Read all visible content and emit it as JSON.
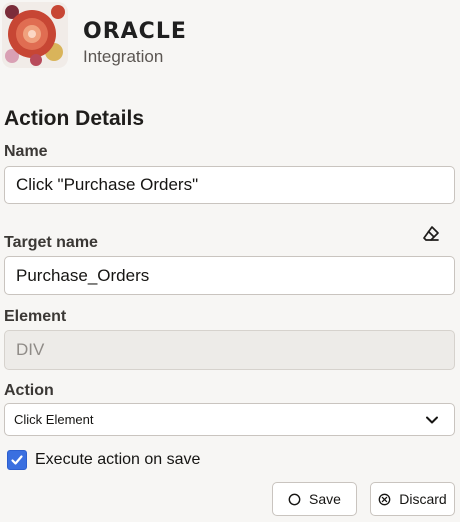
{
  "header": {
    "brand_name": "ORACLE",
    "product_name": "Integration"
  },
  "form": {
    "section_title": "Action Details",
    "name": {
      "label": "Name",
      "value": "Click \"Purchase Orders\""
    },
    "target_name": {
      "label": "Target name",
      "value": "Purchase_Orders",
      "clear_icon": "eraser-icon"
    },
    "element": {
      "label": "Element",
      "value": "DIV"
    },
    "action": {
      "label": "Action",
      "selected": "Click Element"
    },
    "execute_on_save": {
      "label": "Execute action on save",
      "checked": true
    }
  },
  "buttons": {
    "save_label": "Save",
    "discard_label": "Discard"
  },
  "colors": {
    "background": "#f7f6f4",
    "checkbox_accent": "#3a6fe0",
    "logo_primary": "#c74634",
    "logo_secondary": "#d9b45a"
  }
}
